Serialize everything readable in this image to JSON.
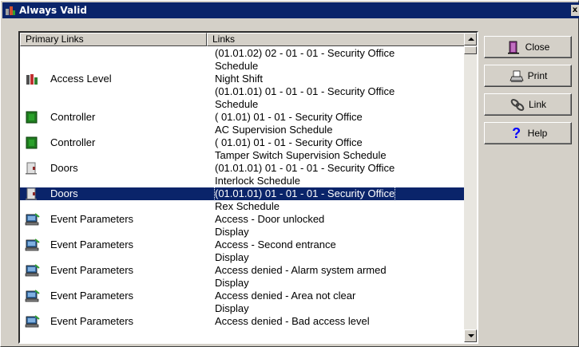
{
  "window": {
    "title": "Always Valid",
    "close_glyph": "x"
  },
  "table": {
    "headers": [
      "Primary Links",
      "Links"
    ],
    "lines": [
      {
        "primary": "",
        "icon": "",
        "link": "(01.01.02) 02 - 01 - 01 - Security Office",
        "selected": false
      },
      {
        "primary": "",
        "icon": "",
        "link": "Schedule",
        "selected": false
      },
      {
        "primary": "Access Level",
        "icon": "access-level-icon",
        "link": "Night Shift",
        "selected": false
      },
      {
        "primary": "",
        "icon": "",
        "link": "(01.01.01) 01 - 01 - 01 - Security Office",
        "selected": false
      },
      {
        "primary": "",
        "icon": "",
        "link": "Schedule",
        "selected": false
      },
      {
        "primary": "Controller",
        "icon": "controller-icon",
        "link": "( 01.01) 01 - 01 - Security Office",
        "selected": false
      },
      {
        "primary": "",
        "icon": "",
        "link": "AC Supervision Schedule",
        "selected": false
      },
      {
        "primary": "Controller",
        "icon": "controller-icon",
        "link": "( 01.01) 01 - 01 - Security Office",
        "selected": false
      },
      {
        "primary": "",
        "icon": "",
        "link": "Tamper Switch Supervision Schedule",
        "selected": false
      },
      {
        "primary": "Doors",
        "icon": "door-icon",
        "link": "(01.01.01) 01 - 01 - 01 - Security Office",
        "selected": false
      },
      {
        "primary": "",
        "icon": "",
        "link": "Interlock Schedule",
        "selected": false
      },
      {
        "primary": "Doors",
        "icon": "door-icon",
        "link": "(01.01.01) 01 - 01 - 01 - Security Office",
        "selected": true
      },
      {
        "primary": "",
        "icon": "",
        "link": "Rex Schedule",
        "selected": false
      },
      {
        "primary": "Event Parameters",
        "icon": "event-parameters-icon",
        "link": "Access - Door unlocked",
        "selected": false
      },
      {
        "primary": "",
        "icon": "",
        "link": "Display",
        "selected": false
      },
      {
        "primary": "Event Parameters",
        "icon": "event-parameters-icon",
        "link": "Access - Second entrance",
        "selected": false
      },
      {
        "primary": "",
        "icon": "",
        "link": "Display",
        "selected": false
      },
      {
        "primary": "Event Parameters",
        "icon": "event-parameters-icon",
        "link": "Access denied - Alarm system armed",
        "selected": false
      },
      {
        "primary": "",
        "icon": "",
        "link": "Display",
        "selected": false
      },
      {
        "primary": "Event Parameters",
        "icon": "event-parameters-icon",
        "link": "Access denied - Area not clear",
        "selected": false
      },
      {
        "primary": "",
        "icon": "",
        "link": "Display",
        "selected": false
      },
      {
        "primary": "Event Parameters",
        "icon": "event-parameters-icon",
        "link": "Access denied - Bad access level",
        "selected": false
      }
    ]
  },
  "buttons": {
    "close": {
      "label": "Close",
      "icon": "door-exit-icon"
    },
    "print": {
      "label": "Print",
      "icon": "printer-icon"
    },
    "link": {
      "label": "Link",
      "icon": "chain-link-icon"
    },
    "help": {
      "label": "Help",
      "icon": "question-mark-icon"
    }
  },
  "colors": {
    "selection": "#0a246a",
    "window_bg": "#d4d0c8",
    "help_icon": "#0000ff"
  }
}
